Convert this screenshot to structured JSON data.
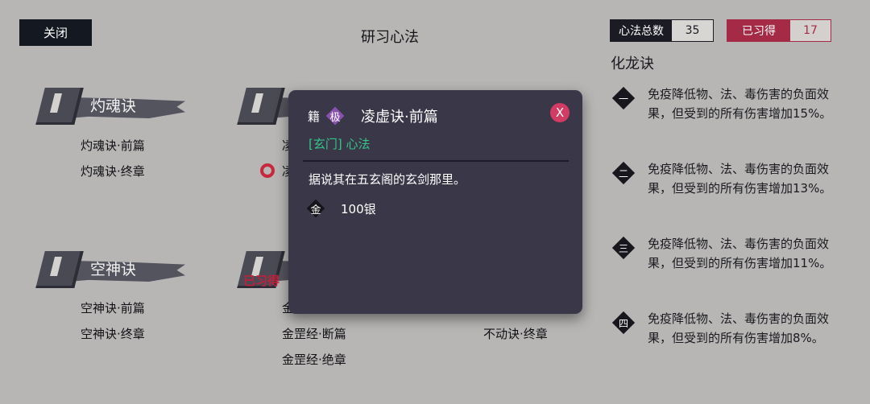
{
  "header": {
    "close_label": "关闭",
    "title": "研习心法",
    "total_label": "心法总数",
    "total_value": "35",
    "learned_label": "已习得",
    "learned_value": "17"
  },
  "categories": [
    {
      "name": "灼魂诀",
      "entries": [
        "灼魂诀·前篇",
        "灼魂诀·终章"
      ]
    },
    {
      "name": "",
      "entries": [
        "凌",
        "凌"
      ]
    },
    {
      "name": "空神诀",
      "entries": [
        "空神诀·前篇",
        "空神诀·终章"
      ]
    },
    {
      "name": "",
      "tag": "已习得",
      "entries": [
        "金",
        "金罡经·断篇",
        "金罡经·绝章"
      ]
    },
    {
      "name": "",
      "entries": [
        "不动诀·终章"
      ]
    }
  ],
  "detail": {
    "title": "化龙诀",
    "effects": [
      {
        "tier": "一",
        "text": "免疫降低物、法、毒伤害的负面效果，但受到的所有伤害增加15%。"
      },
      {
        "tier": "二",
        "text": "免疫降低物、法、毒伤害的负面效果，但受到的所有伤害增加13%。"
      },
      {
        "tier": "三",
        "text": "免疫降低物、法、毒伤害的负面效果，但受到的所有伤害增加11%。"
      },
      {
        "tier": "四",
        "text": "免疫降低物、法、毒伤害的负面效果，但受到的所有伤害增加8%。"
      }
    ]
  },
  "popup": {
    "type_badge": "籍",
    "grade_badge": "极",
    "name": "凌虚诀·前篇",
    "close_label": "X",
    "sect": "[玄门] 心法",
    "description": "据说其在五玄阁的玄剑那里。",
    "currency_icon": "金",
    "price": "100银"
  },
  "colors": {
    "background": "#b7b6b4",
    "popup_bg": "#3a3748",
    "accent_red": "#a52a45",
    "sect_green": "#34c58a",
    "grade_purple": "#8a52b0"
  }
}
